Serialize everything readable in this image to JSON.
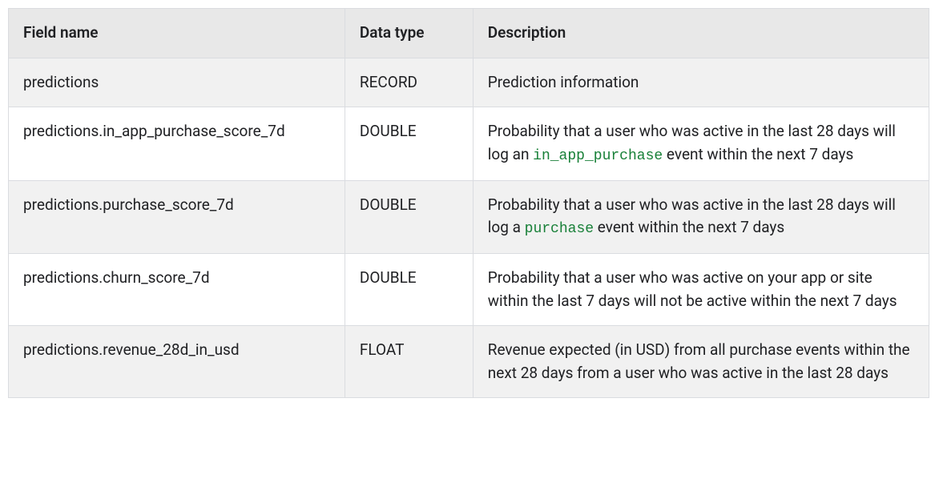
{
  "table": {
    "headers": {
      "field_name": "Field name",
      "data_type": "Data type",
      "description": "Description"
    },
    "rows": [
      {
        "field": "predictions",
        "type": "RECORD",
        "desc_pre": "Prediction information",
        "code": "",
        "desc_post": "",
        "shaded": true
      },
      {
        "field": "predictions.in_app_purchase_score_7d",
        "type": "DOUBLE",
        "desc_pre": "Probability that a user who was active in the last 28 days will log an ",
        "code": "in_app_purchase",
        "desc_post": " event within the next 7 days",
        "shaded": false
      },
      {
        "field": "predictions.purchase_score_7d",
        "type": "DOUBLE",
        "desc_pre": "Probability that a user who was active in the last 28 days will log a ",
        "code": "purchase",
        "desc_post": " event within the next 7 days",
        "shaded": true
      },
      {
        "field": "predictions.churn_score_7d",
        "type": "DOUBLE",
        "desc_pre": "Probability that a user who was active on your app or site within the last 7 days will not be active within the next 7 days",
        "code": "",
        "desc_post": "",
        "shaded": false
      },
      {
        "field": "predictions.revenue_28d_in_usd",
        "type": "FLOAT",
        "desc_pre": "Revenue expected (in USD) from all purchase events within the next 28 days from a user who was active in the last 28 days",
        "code": "",
        "desc_post": "",
        "shaded": true
      }
    ]
  }
}
